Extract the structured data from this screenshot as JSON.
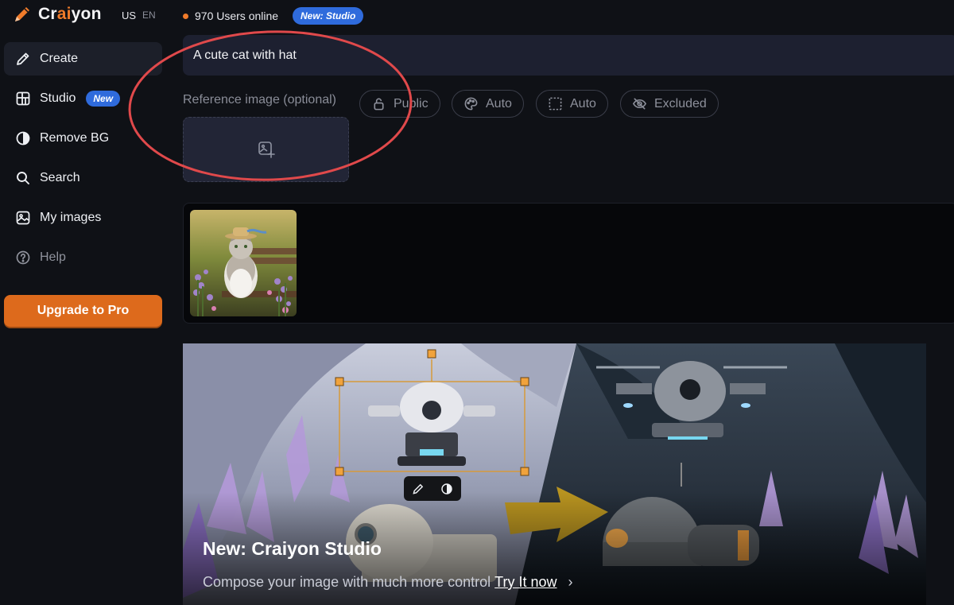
{
  "header": {
    "logo_prefix": "Cr",
    "logo_mid": "ai",
    "logo_suffix": "yon",
    "lang_us": "US",
    "lang_en": "EN",
    "users_online": "970 Users online",
    "new_studio_badge": "New: Studio"
  },
  "sidebar": {
    "items": [
      {
        "label": "Create",
        "icon": "pencil-icon"
      },
      {
        "label": "Studio",
        "icon": "studio-grid-icon",
        "badge": "New"
      },
      {
        "label": "Remove BG",
        "icon": "half-circle-icon"
      },
      {
        "label": "Search",
        "icon": "search-icon"
      },
      {
        "label": "My images",
        "icon": "image-icon"
      },
      {
        "label": "Help",
        "icon": "help-icon"
      }
    ],
    "upgrade_label": "Upgrade to Pro"
  },
  "prompt": {
    "value": "A cute cat with hat"
  },
  "options": {
    "reference_label": "Reference image (optional)",
    "visibility": "Public",
    "style": "Auto",
    "aspect": "Auto",
    "negative": "Excluded"
  },
  "banner": {
    "title": "New: Craiyon Studio",
    "subtitle": "Compose your image with much more control",
    "link": "Try It now",
    "chevron": "›"
  },
  "colors": {
    "accent_orange": "#dd6a1c",
    "badge_blue": "#2f6bdc",
    "annotation_red": "#e0494b"
  }
}
